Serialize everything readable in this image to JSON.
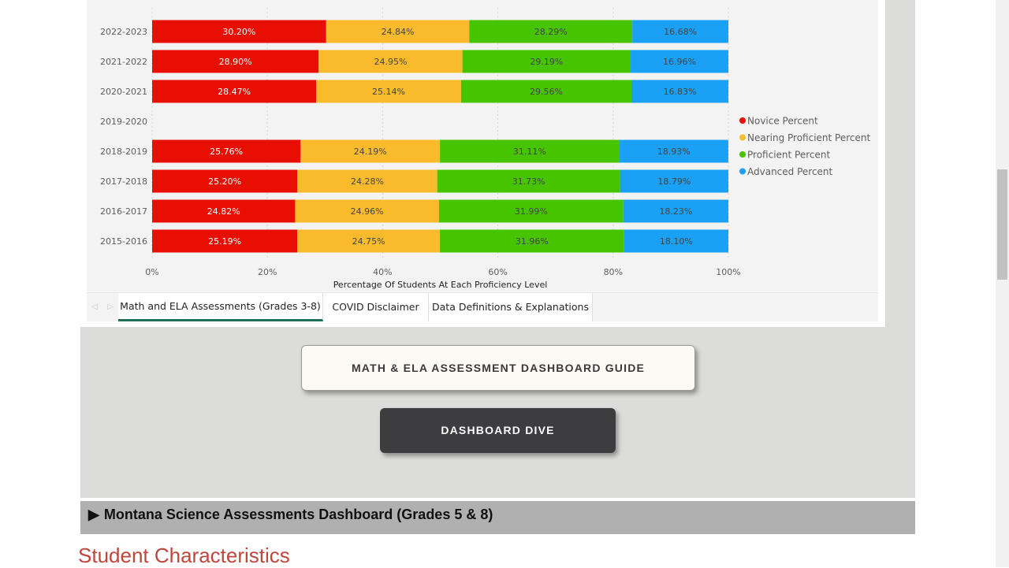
{
  "chart_data": {
    "type": "bar",
    "orientation": "horizontal",
    "stacked": true,
    "categories": [
      "2022-2023",
      "2021-2022",
      "2020-2021",
      "2019-2020",
      "2018-2019",
      "2017-2018",
      "2016-2017",
      "2015-2016"
    ],
    "series": [
      {
        "name": "Novice Percent",
        "color": "#e80e02",
        "values": [
          30.2,
          28.9,
          28.47,
          null,
          25.76,
          25.2,
          24.82,
          25.19
        ]
      },
      {
        "name": "Nearing Proficient Percent",
        "color": "#f9bb2b",
        "values": [
          24.84,
          24.95,
          25.14,
          null,
          24.19,
          24.28,
          24.96,
          24.75
        ]
      },
      {
        "name": "Proficient Percent",
        "color": "#46c400",
        "values": [
          28.29,
          29.19,
          29.56,
          null,
          31.11,
          31.73,
          31.99,
          31.96
        ]
      },
      {
        "name": "Advanced Percent",
        "color": "#1aa1f5",
        "values": [
          16.68,
          16.96,
          16.83,
          null,
          18.93,
          18.79,
          18.23,
          18.1
        ]
      }
    ],
    "labels": [
      [
        "30.20%",
        "28.90%",
        "28.47%",
        "",
        "25.76%",
        "25.20%",
        "24.82%",
        "25.19%"
      ],
      [
        "24.84%",
        "24.95%",
        "25.14%",
        "",
        "24.19%",
        "24.28%",
        "24.96%",
        "24.75%"
      ],
      [
        "28.29%",
        "29.19%",
        "29.56%",
        "",
        "31.11%",
        "31.73%",
        "31.99%",
        "31.96%"
      ],
      [
        "16.68%",
        "16.96%",
        "16.83%",
        "",
        "18.93%",
        "18.79%",
        "18.23%",
        "18.10%"
      ]
    ],
    "xticks": [
      "0%",
      "20%",
      "40%",
      "60%",
      "80%",
      "100%"
    ],
    "xlim": [
      0,
      100
    ],
    "xlabel": "Percentage Of Students At Each Proficiency Level",
    "ylabel": "",
    "title": "",
    "grid": true,
    "legend_position": "right"
  },
  "tabs": {
    "nav_prev": "◁",
    "nav_next": "▷",
    "items": [
      {
        "label": "Math and ELA Assessments (Grades 3-8)",
        "active": true
      },
      {
        "label": "COVID Disclaimer",
        "active": false
      },
      {
        "label": "Data Definitions & Explanations",
        "active": false
      }
    ]
  },
  "buttons": {
    "guide_label": "MATH & ELA ASSESSMENT DASHBOARD GUIDE",
    "dive_label": "DASHBOARD DIVE"
  },
  "science_section": {
    "marker": "▶",
    "label": "Montana Science Assessments Dashboard (Grades 5 & 8)"
  },
  "section_heading": "Student Characteristics"
}
